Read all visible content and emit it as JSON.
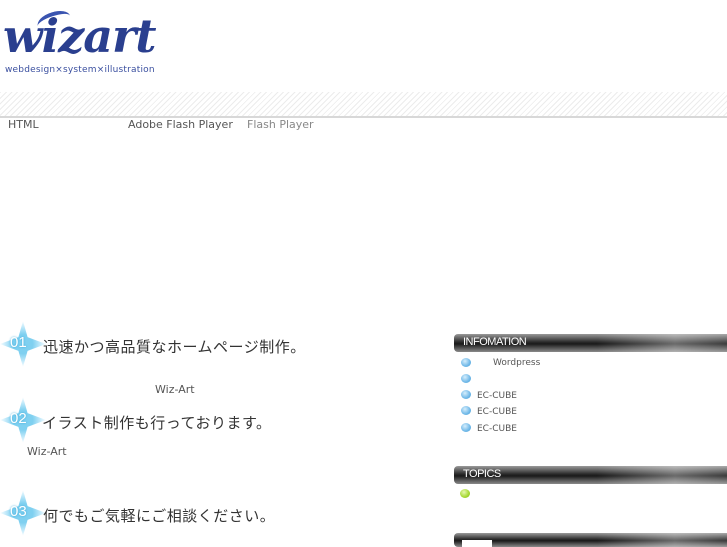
{
  "logo": {
    "word": "wizart",
    "tagline": "webdesign×system×illustration"
  },
  "notice": {
    "left": "HTML",
    "middle": "Adobe Flash Player",
    "right": "Flash Player"
  },
  "features": [
    {
      "num": "01",
      "text": "迅速かつ高品質なホームページ制作。",
      "sub": "Wiz-Art"
    },
    {
      "num": "02",
      "text": "イラスト制作も行っております。",
      "sub": "Wiz-Art"
    },
    {
      "num": "03",
      "text": "何でもご気軽にご相談ください。"
    }
  ],
  "sidebar": {
    "info_title": "INFOMATION",
    "info_items": [
      "Wordpress",
      "",
      "EC-CUBE",
      "EC-CUBE",
      "EC-CUBE"
    ],
    "topics_title": "TOPICS",
    "third_title": ""
  },
  "colors": {
    "logo": "#2a3f8f",
    "badge": "#7fd0f0",
    "info_dot": "#6fb8e8",
    "topics_dot": "#a6d832",
    "bar": "#1a1a1a"
  }
}
